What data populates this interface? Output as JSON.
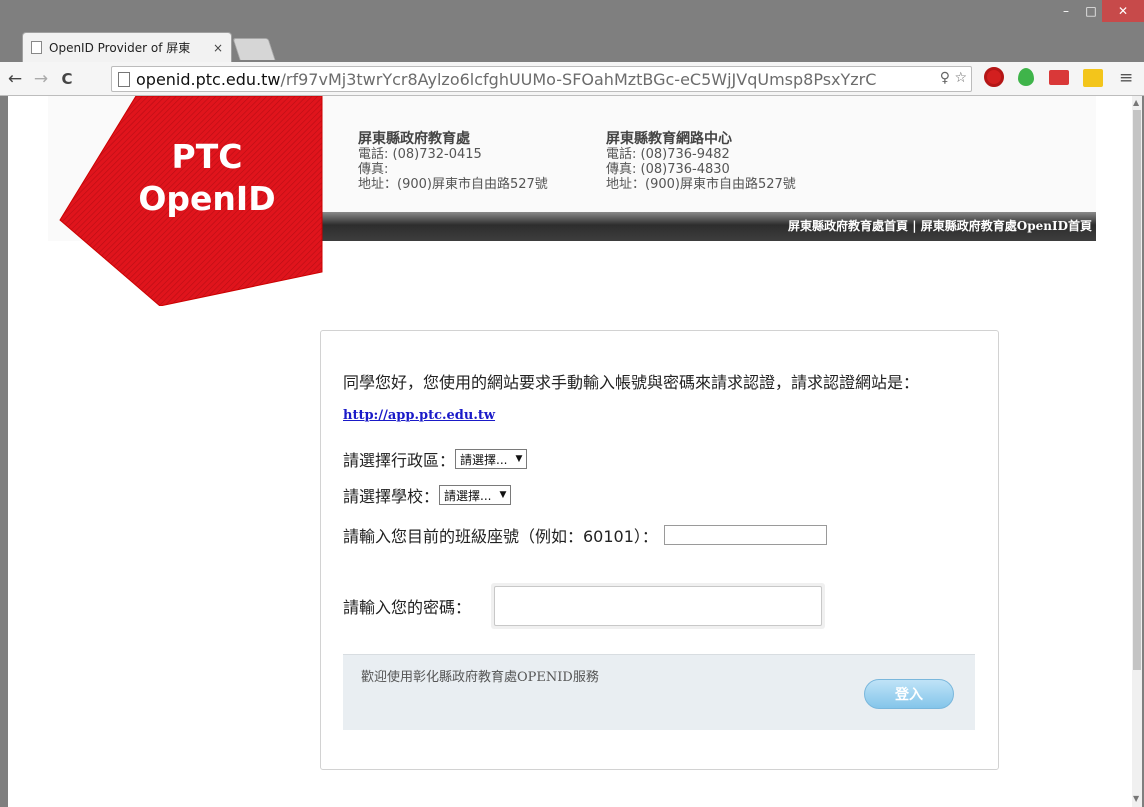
{
  "browser": {
    "tab_title": "OpenID Provider of 屏東",
    "tab_close": "×",
    "url_host": "openid.ptc.edu.tw",
    "url_path": "/rf97vMj3twrYcr8Aylzo6lcfghUUMo-SFOahMztBGc-eC5WjJVqUmsp8PsxYzrC",
    "win_minimize": "–",
    "win_maximize": "□",
    "win_close": "✕",
    "back": "←",
    "forward": "→",
    "reload": "C",
    "omni_icons": "♀ ☆",
    "menu": "≡"
  },
  "header": {
    "logo_line1": "PTC",
    "logo_line2": "OpenID",
    "contact1": {
      "org": "屏東縣政府教育處",
      "phone": "電話: (08)732-0415",
      "fax": "傳真:",
      "address": "地址：(900)屏東市自由路527號"
    },
    "contact2": {
      "org": "屏東縣教育網路中心",
      "phone": "電話: (08)736-9482",
      "fax": "傳真: (08)736-4830",
      "address": "地址：(900)屏東市自由路527號"
    },
    "link_home": "屏東縣政府教育處首頁",
    "link_sep": " | ",
    "link_openid": "屏東縣政府教育處OpenID首頁"
  },
  "form": {
    "intro": "同學您好，您使用的網站要求手動輸入帳號與密碼來請求認證，請求認證網站是：",
    "site_url": "http://app.ptc.edu.tw",
    "district_label": "請選擇行政區：",
    "district_value": "請選擇...",
    "school_label": "請選擇學校：",
    "school_value": "請選擇...",
    "seat_label": "請輸入您目前的班級座號（例如：60101）：",
    "seat_value": "",
    "password_label": "請輸入您的密碼：",
    "password_value": "",
    "welcome": "歡迎使用彰化縣政府教育處OPENID服務",
    "login_button": "登入"
  },
  "colors": {
    "logo_red": "#e0141c",
    "link_blue": "#1a1ac8",
    "button_blue": "#84c5ea"
  }
}
